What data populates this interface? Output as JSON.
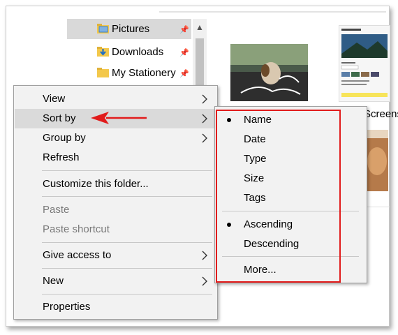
{
  "nav": {
    "items": [
      {
        "label": "Pictures",
        "icon": "pictures-folder-icon",
        "selected": true
      },
      {
        "label": "Downloads",
        "icon": "downloads-folder-icon",
        "selected": false
      },
      {
        "label": "My Stationery",
        "icon": "folder-icon",
        "selected": false
      }
    ]
  },
  "files": {
    "partial_name": "Screensho"
  },
  "context_menu": {
    "view": "View",
    "sort_by": "Sort by",
    "group_by": "Group by",
    "refresh": "Refresh",
    "customize": "Customize this folder...",
    "paste": "Paste",
    "paste_shortcut": "Paste shortcut",
    "give_access": "Give access to",
    "new": "New",
    "properties": "Properties"
  },
  "sort_submenu": {
    "name": "Name",
    "date": "Date",
    "type": "Type",
    "size": "Size",
    "tags": "Tags",
    "ascending": "Ascending",
    "descending": "Descending",
    "more": "More...",
    "selected_field": "Name",
    "selected_order": "Ascending"
  },
  "colors": {
    "highlight_box": "#e11b1b",
    "annotation_arrow": "#e11b1b",
    "menu_bg": "#f2f2f2",
    "hover_bg": "#dadada"
  }
}
